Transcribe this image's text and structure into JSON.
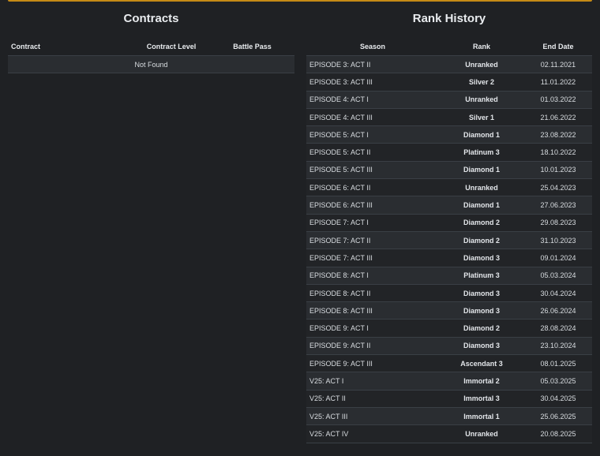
{
  "contracts": {
    "title": "Contracts",
    "columns": [
      "Contract",
      "Contract Level",
      "Battle Pass"
    ],
    "empty_message": "Not Found"
  },
  "rank_history": {
    "title": "Rank History",
    "columns": [
      "Season",
      "Rank",
      "End Date"
    ],
    "rows": [
      {
        "season": "EPISODE 3: ACT II",
        "rank": "Unranked",
        "end_date": "02.11.2021"
      },
      {
        "season": "EPISODE 3: ACT III",
        "rank": "Silver 2",
        "end_date": "11.01.2022"
      },
      {
        "season": "EPISODE 4: ACT I",
        "rank": "Unranked",
        "end_date": "01.03.2022"
      },
      {
        "season": "EPISODE 4: ACT III",
        "rank": "Silver 1",
        "end_date": "21.06.2022"
      },
      {
        "season": "EPISODE 5: ACT I",
        "rank": "Diamond 1",
        "end_date": "23.08.2022"
      },
      {
        "season": "EPISODE 5: ACT II",
        "rank": "Platinum 3",
        "end_date": "18.10.2022"
      },
      {
        "season": "EPISODE 5: ACT III",
        "rank": "Diamond 1",
        "end_date": "10.01.2023"
      },
      {
        "season": "EPISODE 6: ACT II",
        "rank": "Unranked",
        "end_date": "25.04.2023"
      },
      {
        "season": "EPISODE 6: ACT III",
        "rank": "Diamond 1",
        "end_date": "27.06.2023"
      },
      {
        "season": "EPISODE 7: ACT I",
        "rank": "Diamond 2",
        "end_date": "29.08.2023"
      },
      {
        "season": "EPISODE 7: ACT II",
        "rank": "Diamond 2",
        "end_date": "31.10.2023"
      },
      {
        "season": "EPISODE 7: ACT III",
        "rank": "Diamond 3",
        "end_date": "09.01.2024"
      },
      {
        "season": "EPISODE 8: ACT I",
        "rank": "Platinum 3",
        "end_date": "05.03.2024"
      },
      {
        "season": "EPISODE 8: ACT II",
        "rank": "Diamond 3",
        "end_date": "30.04.2024"
      },
      {
        "season": "EPISODE 8: ACT III",
        "rank": "Diamond 3",
        "end_date": "26.06.2024"
      },
      {
        "season": "EPISODE 9: ACT I",
        "rank": "Diamond 2",
        "end_date": "28.08.2024"
      },
      {
        "season": "EPISODE 9: ACT II",
        "rank": "Diamond 3",
        "end_date": "23.10.2024"
      },
      {
        "season": "EPISODE 9: ACT III",
        "rank": "Ascendant 3",
        "end_date": "08.01.2025"
      },
      {
        "season": "V25: ACT I",
        "rank": "Immortal 2",
        "end_date": "05.03.2025"
      },
      {
        "season": "V25: ACT II",
        "rank": "Immortal 3",
        "end_date": "30.04.2025"
      },
      {
        "season": "V25: ACT III",
        "rank": "Immortal 1",
        "end_date": "25.06.2025"
      },
      {
        "season": "V25: ACT IV",
        "rank": "Unranked",
        "end_date": "20.08.2025"
      }
    ]
  }
}
